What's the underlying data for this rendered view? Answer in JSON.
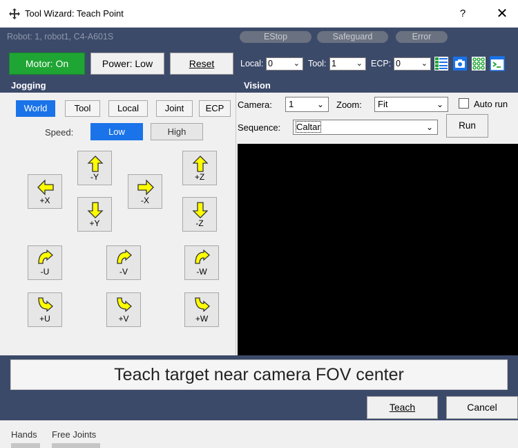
{
  "window": {
    "title": "Tool Wizard: Teach Point",
    "help_label": "?",
    "close_label": "✕"
  },
  "status": {
    "robot_info": "Robot: 1, robot1, C4-A601S",
    "estop": "EStop",
    "safeguard": "Safeguard",
    "error": "Error"
  },
  "toolbar": {
    "motor": "Motor: On",
    "power": "Power: Low",
    "reset": "Reset",
    "local_label": "Local:",
    "local_value": "0",
    "tool_label": "Tool:",
    "tool_value": "1",
    "ecp_label": "ECP:",
    "ecp_value": "0"
  },
  "jogging": {
    "header": "Jogging",
    "frames": [
      "World",
      "Tool",
      "Local",
      "Joint",
      "ECP"
    ],
    "active_frame": "World",
    "speed_label": "Speed:",
    "speed_low": "Low",
    "speed_high": "High",
    "buttons": {
      "minus_y": "-Y",
      "plus_x": "+X",
      "minus_x": "-X",
      "plus_y": "+Y",
      "plus_z": "+Z",
      "minus_z": "-Z",
      "minus_u": "-U",
      "minus_v": "-V",
      "minus_w": "-W",
      "plus_u": "+U",
      "plus_v": "+V",
      "plus_w": "+W"
    }
  },
  "vision": {
    "header": "Vision",
    "camera_label": "Camera:",
    "camera_value": "1",
    "zoom_label": "Zoom:",
    "zoom_value": "Fit",
    "auto_run_label": "Auto run",
    "auto_run_checked": false,
    "sequence_label": "Sequence:",
    "sequence_value": "Caltar",
    "run_label": "Run"
  },
  "instruction": "Teach target near camera FOV center",
  "actions": {
    "teach": "Teach",
    "cancel": "Cancel"
  },
  "footer": {
    "tab_hands": "Hands",
    "tab_free_joints": "Free Joints"
  },
  "colors": {
    "panel_dark": "#3c4a6a",
    "motor_green": "#1fa533",
    "active_blue": "#1a73e8",
    "arrow_yellow": "#ffff00"
  }
}
